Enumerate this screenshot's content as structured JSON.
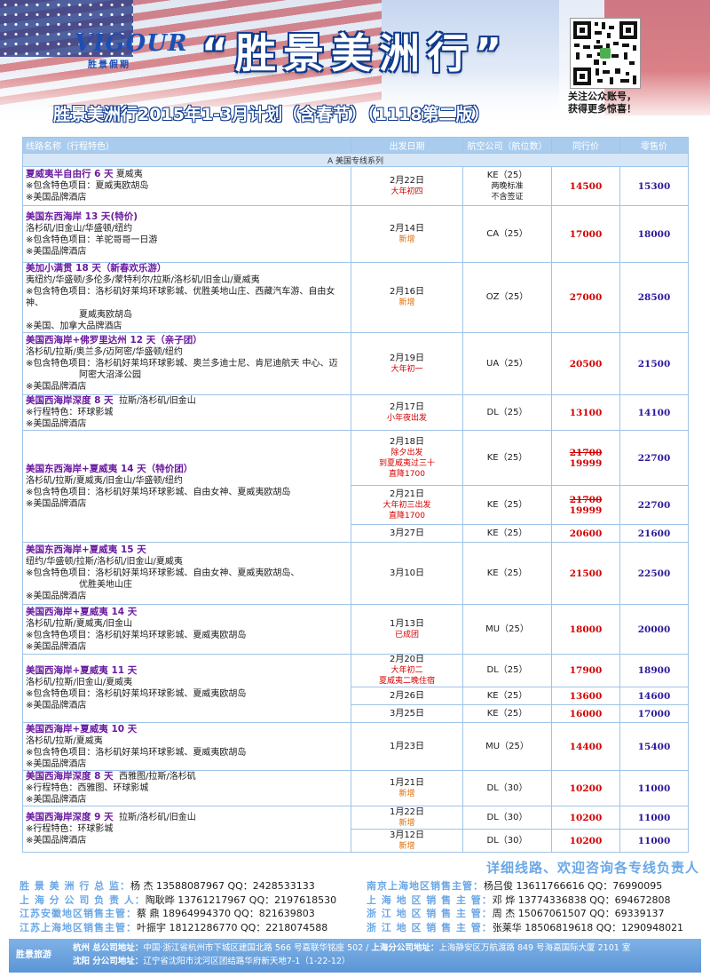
{
  "header": {
    "logo_mark": "VIGOUR",
    "logo_sub": "胜景假期",
    "brand_title": "“胜景美洲行”",
    "qr_caption_line1": "关注公众账号，",
    "qr_caption_line2": "获得更多惊喜！",
    "subtitle": "胜景美洲行2015年1-3月计划（含春节）（1118第二版）"
  },
  "table": {
    "headers": {
      "route": "线路名称（行程特色）",
      "date": "出发日期",
      "airline": "航空公司（航位数）",
      "peer": "同行价",
      "retail": "零售价"
    },
    "section": "A 美国专线系列",
    "rows": [
      {
        "name": "夏威夷半自由行 6 天",
        "name_extra": "夏威夷",
        "features": [
          "※包含特色项目：夏威夷欧胡岛",
          "※美国品牌酒店"
        ],
        "date": "2月22日",
        "note": "大年初四",
        "airline": "KE（25）",
        "air_note1": "两晚标准",
        "air_note2": "不含签证",
        "peer": "14500",
        "retail": "15300"
      },
      {
        "name": "美国东西海岸 13 天",
        "name_tag": "(特价)",
        "line": "洛杉矶/旧金山/华盛顿/纽约",
        "features": [
          "※包含特色项目：羊驼哥哥一日游",
          "※美国品牌酒店"
        ],
        "date": "2月14日",
        "note": "新增",
        "airline": "CA（25）",
        "peer": "17000",
        "retail": "18000"
      },
      {
        "name": "美加小满贯 18 天",
        "name_tag": "（新春欢乐游）",
        "line": "夷纽约/华盛顿/多伦多/蒙特利尔/拉斯/洛杉矶/旧金山/夏威夷",
        "features": [
          "※包含特色项目：洛杉矶好莱坞环球影城、优胜美地山庄、西藏汽车游、自由女神、",
          "夏威夷欧胡岛",
          "※美国、加拿大品牌酒店"
        ],
        "date": "2月16日",
        "note": "新增",
        "airline": "OZ（25）",
        "peer": "27000",
        "retail": "28500"
      },
      {
        "name": "美国西海岸+佛罗里达州 12 天",
        "name_tag": "（亲子团）",
        "line": "洛杉矶/拉斯/奥兰多/迈阿密/华盛顿/纽约",
        "features": [
          "※包含特色项目：洛杉矶好莱坞环球影城、奥兰多迪士尼、肯尼迪航天 中心、迈",
          "阿密大沼泽公园",
          "※美国品牌酒店"
        ],
        "date": "2月19日",
        "note": "大年初一",
        "airline": "UA（25）",
        "peer": "20500",
        "retail": "21500"
      },
      {
        "name": "美国西海岸深度 8 天",
        "name_extra": "拉斯/洛杉矶/旧金山",
        "features": [
          "※行程特色：环球影城",
          "※美国品牌酒店"
        ],
        "date": "2月17日",
        "note": "小年夜出发",
        "airline": "DL（25）",
        "peer": "13100",
        "retail": "14100"
      },
      {
        "name": "美国东西海岸+夏威夷 14 天",
        "name_tag": "（特价团）",
        "line": "洛杉矶/拉斯/夏威夷/旧金山/华盛顿/纽约",
        "features": [
          "※包含特色项目：洛杉矶好莱坞环球影城、自由女神、夏威夷欧胡岛",
          "※美国品牌酒店"
        ],
        "departures": [
          {
            "date": "2月18日",
            "note1": "除夕出发",
            "note2": "到夏威夷过三十",
            "note3": "直降1700",
            "airline": "KE（25）",
            "peer_orig": "21700",
            "peer": "19999",
            "retail": "22700"
          },
          {
            "date": "2月21日",
            "note1": "大年初三出发",
            "note2": "直降1700",
            "airline": "KE（25）",
            "peer_orig": "21700",
            "peer": "19999",
            "retail": "22700"
          },
          {
            "date": "3月27日",
            "airline": "KE（25）",
            "peer": "20600",
            "retail": "21600"
          }
        ]
      },
      {
        "name": "美国东西海岸+夏威夷 15 天",
        "line": "纽约/华盛顿/拉斯/洛杉矶/旧金山/夏威夷",
        "features": [
          "※包含特色项目：洛杉矶好莱坞环球影城、自由女神、夏威夷欧胡岛、",
          "优胜美地山庄",
          "※美国品牌酒店"
        ],
        "date": "3月10日",
        "airline": "KE（25）",
        "peer": "21500",
        "retail": "22500"
      },
      {
        "name": "美国西海岸+夏威夷 14 天",
        "line": "洛杉矶/拉斯/夏威夷/旧金山",
        "features": [
          "※包含特色项目：洛杉矶好莱坞环球影城、夏威夷欧胡岛",
          "※美国品牌酒店"
        ],
        "date": "1月13日",
        "note": "已成团",
        "airline": "MU（25）",
        "peer": "18000",
        "retail": "20000"
      },
      {
        "name": "美国西海岸+夏威夷 11 天",
        "line": "洛杉矶/拉斯/旧金山/夏威夷",
        "features": [
          "※包含特色项目：洛杉矶好莱坞环球影城、夏威夷欧胡岛",
          "※美国品牌酒店"
        ],
        "departures": [
          {
            "date": "2月20日",
            "note1": "大年初二",
            "note2": "夏威夷二晚住宿",
            "airline": "DL（25）",
            "peer": "17900",
            "retail": "18900"
          },
          {
            "date": "2月26日",
            "airline": "KE（25）",
            "peer": "13600",
            "retail": "14600"
          },
          {
            "date": "3月25日",
            "airline": "KE（25）",
            "peer": "16000",
            "retail": "17000"
          }
        ]
      },
      {
        "name": "美国西海岸+夏威夷 10 天",
        "line": "洛杉矶/拉斯/夏威夷",
        "features": [
          "※包含特色项目：洛杉矶好莱坞环球影城、夏威夷欧胡岛",
          "※美国品牌酒店"
        ],
        "date": "1月23日",
        "airline": "MU（25）",
        "peer": "14400",
        "retail": "15400"
      },
      {
        "name": "美国西海岸深度 8 天",
        "name_extra": "西雅图/拉斯/洛杉矶",
        "features": [
          "※行程特色：西雅图、环球影城",
          "※美国品牌酒店"
        ],
        "date": "1月21日",
        "note": "新增",
        "airline": "DL（30）",
        "peer": "10200",
        "retail": "11000"
      },
      {
        "name": "美国西海岸深度 9 天",
        "name_extra": "拉斯/洛杉矶/旧金山",
        "features": [
          "※行程特色：环球影城",
          "※美国品牌酒店"
        ],
        "departures": [
          {
            "date": "1月22日",
            "note1": "新增",
            "airline": "DL（30）",
            "peer": "10200",
            "retail": "11000"
          },
          {
            "date": "3月12日",
            "note1": "新增",
            "airline": "DL（30）",
            "peer": "10200",
            "retail": "11000"
          }
        ]
      }
    ]
  },
  "footer": {
    "consult": "详细线路、欢迎咨询各专线负责人",
    "contacts": [
      {
        "label": "胜 景 美 洲 行 总 监：",
        "value": "杨    杰 13588087967  QQ：2428533133",
        "label2": "南京上海地区销售主管：",
        "value2": "杨吕俊 13611766616  QQ：76990095"
      },
      {
        "label": "上 海 分 公 司 负 责 人：",
        "value": "陶耿晔 13761217967  QQ：2197618530",
        "label2": "上 海 地 区 销 售 主 管：",
        "value2": "邓    烨 13774336838  QQ：694672808"
      },
      {
        "label": "江苏安徽地区销售主管：",
        "value": "蔡    鼎 18964994370  QQ：821639803",
        "label2": "浙 江 地 区 销 售 主 管：",
        "value2": "周    杰 15067061507  QQ：69339137"
      },
      {
        "label": "江苏上海地区销售主管：",
        "value": "叶振宇 18121286770  QQ：2218074588",
        "label2": "浙 江 地 区 销 售 主 管：",
        "value2": "张莱华 18506819618  QQ：1290948021"
      }
    ],
    "addr_brand": "胜景旅游",
    "addr_label1": "杭州 总公司地址：",
    "addr_value1": "中国·浙江省杭州市下城区建国北路 566 号嘉联华铭座 502 /",
    "addr_label1b": "上海分公司地址：",
    "addr_value1b": "上海静安区万航渡路 849 号海嘉国际大厦 2101 室",
    "addr_label2": "沈阳 分公司地址：",
    "addr_value2": "辽宁省沈阳市沈河区团结路华府新天地7-1（1-22-12）"
  }
}
